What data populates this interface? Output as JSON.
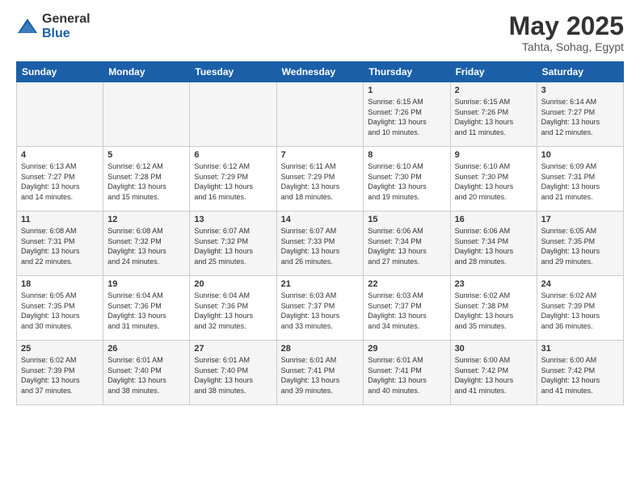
{
  "header": {
    "logo_general": "General",
    "logo_blue": "Blue",
    "month": "May 2025",
    "location": "Tahta, Sohag, Egypt"
  },
  "days_of_week": [
    "Sunday",
    "Monday",
    "Tuesday",
    "Wednesday",
    "Thursday",
    "Friday",
    "Saturday"
  ],
  "weeks": [
    [
      {
        "day": "",
        "info": ""
      },
      {
        "day": "",
        "info": ""
      },
      {
        "day": "",
        "info": ""
      },
      {
        "day": "",
        "info": ""
      },
      {
        "day": "1",
        "info": "Sunrise: 6:15 AM\nSunset: 7:26 PM\nDaylight: 13 hours\nand 10 minutes."
      },
      {
        "day": "2",
        "info": "Sunrise: 6:15 AM\nSunset: 7:26 PM\nDaylight: 13 hours\nand 11 minutes."
      },
      {
        "day": "3",
        "info": "Sunrise: 6:14 AM\nSunset: 7:27 PM\nDaylight: 13 hours\nand 12 minutes."
      }
    ],
    [
      {
        "day": "4",
        "info": "Sunrise: 6:13 AM\nSunset: 7:27 PM\nDaylight: 13 hours\nand 14 minutes."
      },
      {
        "day": "5",
        "info": "Sunrise: 6:12 AM\nSunset: 7:28 PM\nDaylight: 13 hours\nand 15 minutes."
      },
      {
        "day": "6",
        "info": "Sunrise: 6:12 AM\nSunset: 7:29 PM\nDaylight: 13 hours\nand 16 minutes."
      },
      {
        "day": "7",
        "info": "Sunrise: 6:11 AM\nSunset: 7:29 PM\nDaylight: 13 hours\nand 18 minutes."
      },
      {
        "day": "8",
        "info": "Sunrise: 6:10 AM\nSunset: 7:30 PM\nDaylight: 13 hours\nand 19 minutes."
      },
      {
        "day": "9",
        "info": "Sunrise: 6:10 AM\nSunset: 7:30 PM\nDaylight: 13 hours\nand 20 minutes."
      },
      {
        "day": "10",
        "info": "Sunrise: 6:09 AM\nSunset: 7:31 PM\nDaylight: 13 hours\nand 21 minutes."
      }
    ],
    [
      {
        "day": "11",
        "info": "Sunrise: 6:08 AM\nSunset: 7:31 PM\nDaylight: 13 hours\nand 22 minutes."
      },
      {
        "day": "12",
        "info": "Sunrise: 6:08 AM\nSunset: 7:32 PM\nDaylight: 13 hours\nand 24 minutes."
      },
      {
        "day": "13",
        "info": "Sunrise: 6:07 AM\nSunset: 7:32 PM\nDaylight: 13 hours\nand 25 minutes."
      },
      {
        "day": "14",
        "info": "Sunrise: 6:07 AM\nSunset: 7:33 PM\nDaylight: 13 hours\nand 26 minutes."
      },
      {
        "day": "15",
        "info": "Sunrise: 6:06 AM\nSunset: 7:34 PM\nDaylight: 13 hours\nand 27 minutes."
      },
      {
        "day": "16",
        "info": "Sunrise: 6:06 AM\nSunset: 7:34 PM\nDaylight: 13 hours\nand 28 minutes."
      },
      {
        "day": "17",
        "info": "Sunrise: 6:05 AM\nSunset: 7:35 PM\nDaylight: 13 hours\nand 29 minutes."
      }
    ],
    [
      {
        "day": "18",
        "info": "Sunrise: 6:05 AM\nSunset: 7:35 PM\nDaylight: 13 hours\nand 30 minutes."
      },
      {
        "day": "19",
        "info": "Sunrise: 6:04 AM\nSunset: 7:36 PM\nDaylight: 13 hours\nand 31 minutes."
      },
      {
        "day": "20",
        "info": "Sunrise: 6:04 AM\nSunset: 7:36 PM\nDaylight: 13 hours\nand 32 minutes."
      },
      {
        "day": "21",
        "info": "Sunrise: 6:03 AM\nSunset: 7:37 PM\nDaylight: 13 hours\nand 33 minutes."
      },
      {
        "day": "22",
        "info": "Sunrise: 6:03 AM\nSunset: 7:37 PM\nDaylight: 13 hours\nand 34 minutes."
      },
      {
        "day": "23",
        "info": "Sunrise: 6:02 AM\nSunset: 7:38 PM\nDaylight: 13 hours\nand 35 minutes."
      },
      {
        "day": "24",
        "info": "Sunrise: 6:02 AM\nSunset: 7:39 PM\nDaylight: 13 hours\nand 36 minutes."
      }
    ],
    [
      {
        "day": "25",
        "info": "Sunrise: 6:02 AM\nSunset: 7:39 PM\nDaylight: 13 hours\nand 37 minutes."
      },
      {
        "day": "26",
        "info": "Sunrise: 6:01 AM\nSunset: 7:40 PM\nDaylight: 13 hours\nand 38 minutes."
      },
      {
        "day": "27",
        "info": "Sunrise: 6:01 AM\nSunset: 7:40 PM\nDaylight: 13 hours\nand 38 minutes."
      },
      {
        "day": "28",
        "info": "Sunrise: 6:01 AM\nSunset: 7:41 PM\nDaylight: 13 hours\nand 39 minutes."
      },
      {
        "day": "29",
        "info": "Sunrise: 6:01 AM\nSunset: 7:41 PM\nDaylight: 13 hours\nand 40 minutes."
      },
      {
        "day": "30",
        "info": "Sunrise: 6:00 AM\nSunset: 7:42 PM\nDaylight: 13 hours\nand 41 minutes."
      },
      {
        "day": "31",
        "info": "Sunrise: 6:00 AM\nSunset: 7:42 PM\nDaylight: 13 hours\nand 41 minutes."
      }
    ]
  ]
}
